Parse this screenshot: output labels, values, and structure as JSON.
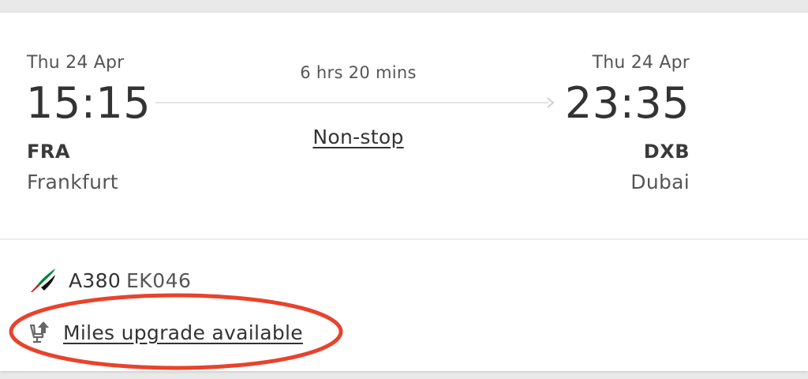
{
  "departure": {
    "date": "Thu 24 Apr",
    "time": "15:15",
    "code": "FRA",
    "city": "Frankfurt"
  },
  "arrival": {
    "date": "Thu 24 Apr",
    "time": "23:35",
    "code": "DXB",
    "city": "Dubai"
  },
  "journey": {
    "duration": "6 hrs 20 mins",
    "stops": "Non-stop"
  },
  "flight": {
    "aircraft": "A380",
    "number": "EK046",
    "upgrade_link": "Miles upgrade available"
  },
  "colors": {
    "annotation": "#e8432d",
    "flag_red": "#d71920",
    "flag_green": "#00843d",
    "flag_black": "#000000"
  },
  "icons": {
    "airline": "airline-flag-logo-icon",
    "upgrade": "seat-upgrade-icon",
    "arrow": "arrow-right-icon"
  }
}
